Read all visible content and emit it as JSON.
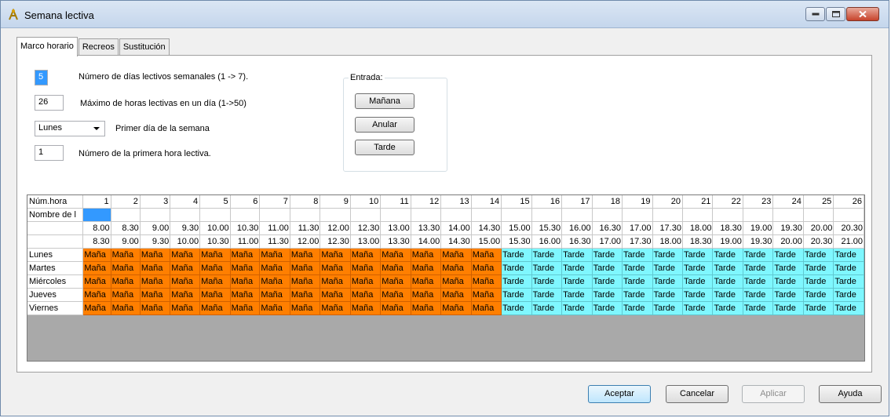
{
  "window": {
    "title": "Semana lectiva"
  },
  "tabs": [
    "Marco horario",
    "Recreos",
    "Sustitución"
  ],
  "settings": {
    "days_value": "5",
    "days_label": "Número de días lectivos semanales (1 -> 7).",
    "max_hours_value": "26",
    "max_hours_label": "Máximo de horas lectivas en un día (1->50)",
    "first_day_value": "Lunes",
    "first_day_label": "Primer día de la semana",
    "first_hour_value": "1",
    "first_hour_label": "Número de la primera hora lectiva."
  },
  "entrada": {
    "title": "Entrada:",
    "manana": "Mañana",
    "anular": "Anular",
    "tarde": "Tarde"
  },
  "grid": {
    "header_num": "Núm.hora",
    "header_name": "Nombre de l",
    "hours": [
      "1",
      "2",
      "3",
      "4",
      "5",
      "6",
      "7",
      "8",
      "9",
      "10",
      "11",
      "12",
      "13",
      "14",
      "15",
      "16",
      "17",
      "18",
      "19",
      "20",
      "21",
      "22",
      "23",
      "24",
      "25",
      "26"
    ],
    "start_times": [
      "8.00",
      "8.30",
      "9.00",
      "9.30",
      "10.00",
      "10.30",
      "11.00",
      "11.30",
      "12.00",
      "12.30",
      "13.00",
      "13.30",
      "14.00",
      "14.30",
      "15.00",
      "15.30",
      "16.00",
      "16.30",
      "17.00",
      "17.30",
      "18.00",
      "18.30",
      "19.00",
      "19.30",
      "20.00",
      "20.30"
    ],
    "end_times": [
      "8.30",
      "9.00",
      "9.30",
      "10.00",
      "10.30",
      "11.00",
      "11.30",
      "12.00",
      "12.30",
      "13.00",
      "13.30",
      "14.00",
      "14.30",
      "15.00",
      "15.30",
      "16.00",
      "16.30",
      "17.00",
      "17.30",
      "18.00",
      "18.30",
      "19.00",
      "19.30",
      "20.00",
      "20.30",
      "21.00"
    ],
    "days": [
      "Lunes",
      "Martes",
      "Miércoles",
      "Jueves",
      "Viernes"
    ],
    "morning_label": "Maña",
    "afternoon_label": "Tarde",
    "morning_hours": 14,
    "colors": {
      "morning": "#ff7f00",
      "afternoon": "#7ff7ff"
    }
  },
  "footer": {
    "aceptar": "Aceptar",
    "cancelar": "Cancelar",
    "aplicar": "Aplicar",
    "ayuda": "Ayuda"
  }
}
